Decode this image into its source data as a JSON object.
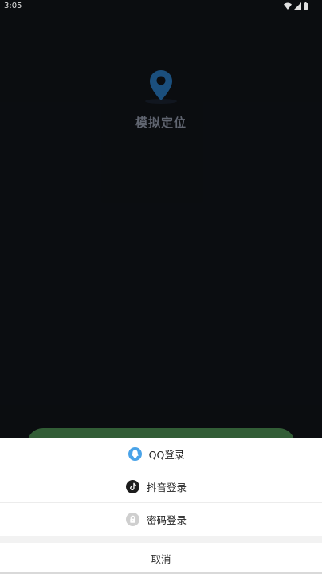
{
  "status_bar": {
    "time": "3:05"
  },
  "app": {
    "title": "模拟定位"
  },
  "sheet": {
    "options": [
      {
        "label": "QQ登录",
        "icon": "qq-icon"
      },
      {
        "label": "抖音登录",
        "icon": "douyin-icon"
      },
      {
        "label": "密码登录",
        "icon": "lock-icon"
      }
    ],
    "cancel_label": "取消"
  }
}
